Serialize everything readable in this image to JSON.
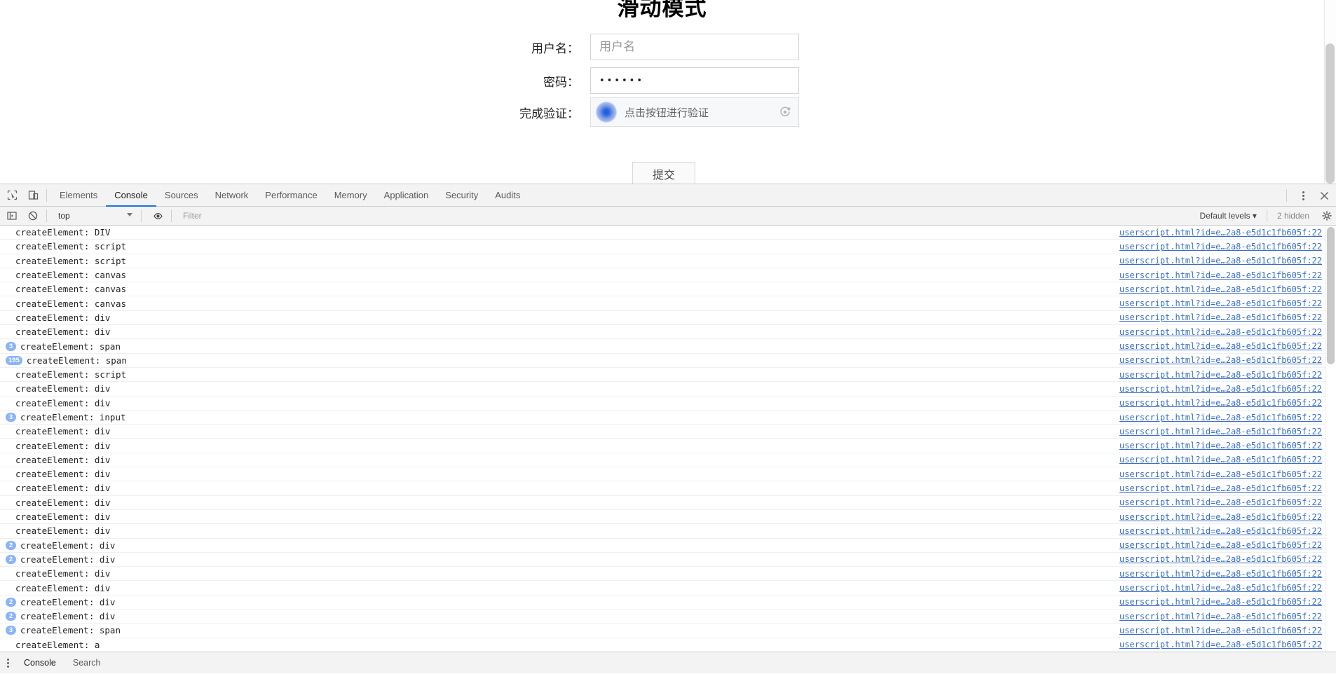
{
  "page": {
    "title": "滑动模式",
    "form": {
      "username": {
        "label": "用户名：",
        "value": "",
        "placeholder": "用户名"
      },
      "password": {
        "label": "密码：",
        "value": "••••••"
      },
      "captcha": {
        "label": "完成验证：",
        "prompt": "点击按钮进行验证",
        "refresh_icon": "refresh-captcha-icon",
        "knob_color": "#2f6ae0"
      },
      "submit_label": "提交"
    }
  },
  "devtools": {
    "left_icons": [
      {
        "name": "inspect-element-icon"
      },
      {
        "name": "device-toolbar-icon"
      }
    ],
    "tabs": [
      {
        "label": "Elements",
        "active": false
      },
      {
        "label": "Console",
        "active": true
      },
      {
        "label": "Sources",
        "active": false
      },
      {
        "label": "Network",
        "active": false
      },
      {
        "label": "Performance",
        "active": false
      },
      {
        "label": "Memory",
        "active": false
      },
      {
        "label": "Application",
        "active": false
      },
      {
        "label": "Security",
        "active": false
      },
      {
        "label": "Audits",
        "active": false
      }
    ],
    "tabbar_right_icons": [
      {
        "name": "more-options-kebab-icon"
      },
      {
        "name": "close-devtools-icon"
      }
    ],
    "filterbar": {
      "sidebar_toggle_icon": "console-sidebar-icon",
      "clear_icon": "clear-console-icon",
      "context": "top",
      "eye_icon": "live-expression-icon",
      "filter_placeholder": "Filter",
      "filter_value": "",
      "levels_label": "Default levels ▾",
      "hidden_label": "2 hidden",
      "settings_icon": "console-settings-gear-icon"
    },
    "active_tab_underline": "#1a73e8",
    "log_source": "userscript.html?id=e…2a8-e5d1c1fb605f:22",
    "logs": [
      {
        "badge": "",
        "text": "createElement: DIV"
      },
      {
        "badge": "",
        "text": "createElement: script"
      },
      {
        "badge": "",
        "text": "createElement: script"
      },
      {
        "badge": "",
        "text": "createElement: canvas"
      },
      {
        "badge": "",
        "text": "createElement: canvas"
      },
      {
        "badge": "",
        "text": "createElement: canvas"
      },
      {
        "badge": "",
        "text": "createElement: div"
      },
      {
        "badge": "",
        "text": "createElement: div"
      },
      {
        "badge": "3",
        "text": "createElement: span"
      },
      {
        "badge": "195",
        "text": "createElement: span"
      },
      {
        "badge": "",
        "text": "createElement: script"
      },
      {
        "badge": "",
        "text": "createElement: div"
      },
      {
        "badge": "",
        "text": "createElement: div"
      },
      {
        "badge": "3",
        "text": "createElement: input"
      },
      {
        "badge": "",
        "text": "createElement: div"
      },
      {
        "badge": "",
        "text": "createElement: div"
      },
      {
        "badge": "",
        "text": "createElement: div"
      },
      {
        "badge": "",
        "text": "createElement: div"
      },
      {
        "badge": "",
        "text": "createElement: div"
      },
      {
        "badge": "",
        "text": "createElement: div"
      },
      {
        "badge": "",
        "text": "createElement: div"
      },
      {
        "badge": "",
        "text": "createElement: div"
      },
      {
        "badge": "2",
        "text": "createElement: div"
      },
      {
        "badge": "2",
        "text": "createElement: div"
      },
      {
        "badge": "",
        "text": "createElement: div"
      },
      {
        "badge": "",
        "text": "createElement: div"
      },
      {
        "badge": "2",
        "text": "createElement: div"
      },
      {
        "badge": "2",
        "text": "createElement: div"
      },
      {
        "badge": "3",
        "text": "createElement: span"
      },
      {
        "badge": "",
        "text": "createElement: a"
      }
    ],
    "drawer": {
      "kebab_icon": "drawer-more-icon",
      "tabs": [
        {
          "label": "Console",
          "active": true
        },
        {
          "label": "Search",
          "active": false
        }
      ]
    }
  }
}
